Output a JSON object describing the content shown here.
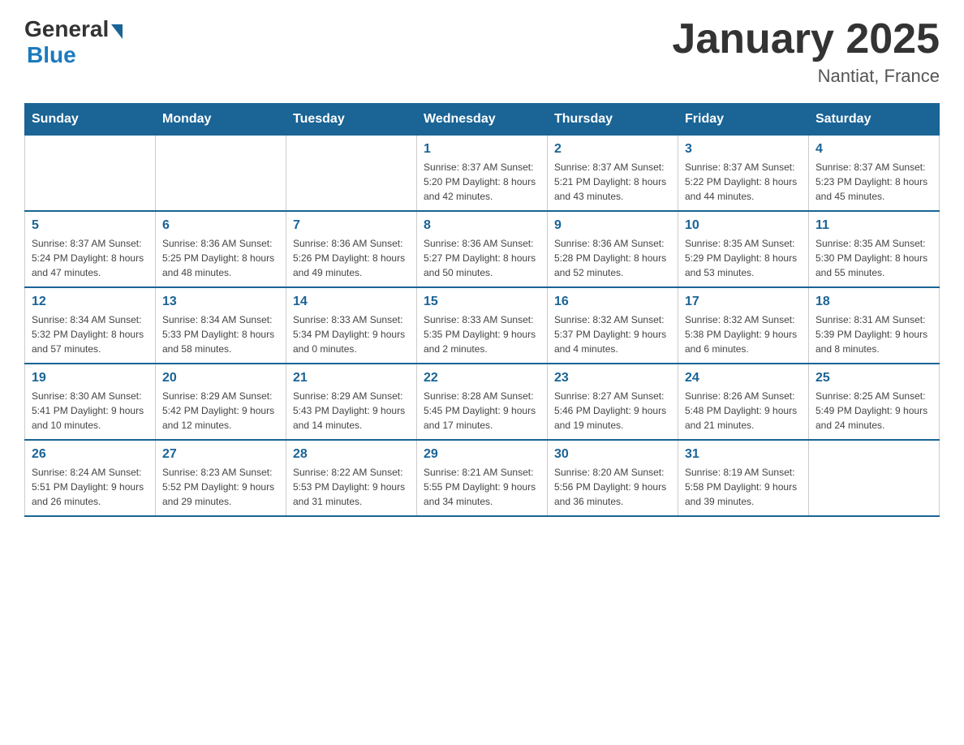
{
  "logo": {
    "general": "General",
    "blue": "Blue"
  },
  "header": {
    "title": "January 2025",
    "location": "Nantiat, France"
  },
  "days_of_week": [
    "Sunday",
    "Monday",
    "Tuesday",
    "Wednesday",
    "Thursday",
    "Friday",
    "Saturday"
  ],
  "weeks": [
    [
      {
        "day": "",
        "info": ""
      },
      {
        "day": "",
        "info": ""
      },
      {
        "day": "",
        "info": ""
      },
      {
        "day": "1",
        "info": "Sunrise: 8:37 AM\nSunset: 5:20 PM\nDaylight: 8 hours\nand 42 minutes."
      },
      {
        "day": "2",
        "info": "Sunrise: 8:37 AM\nSunset: 5:21 PM\nDaylight: 8 hours\nand 43 minutes."
      },
      {
        "day": "3",
        "info": "Sunrise: 8:37 AM\nSunset: 5:22 PM\nDaylight: 8 hours\nand 44 minutes."
      },
      {
        "day": "4",
        "info": "Sunrise: 8:37 AM\nSunset: 5:23 PM\nDaylight: 8 hours\nand 45 minutes."
      }
    ],
    [
      {
        "day": "5",
        "info": "Sunrise: 8:37 AM\nSunset: 5:24 PM\nDaylight: 8 hours\nand 47 minutes."
      },
      {
        "day": "6",
        "info": "Sunrise: 8:36 AM\nSunset: 5:25 PM\nDaylight: 8 hours\nand 48 minutes."
      },
      {
        "day": "7",
        "info": "Sunrise: 8:36 AM\nSunset: 5:26 PM\nDaylight: 8 hours\nand 49 minutes."
      },
      {
        "day": "8",
        "info": "Sunrise: 8:36 AM\nSunset: 5:27 PM\nDaylight: 8 hours\nand 50 minutes."
      },
      {
        "day": "9",
        "info": "Sunrise: 8:36 AM\nSunset: 5:28 PM\nDaylight: 8 hours\nand 52 minutes."
      },
      {
        "day": "10",
        "info": "Sunrise: 8:35 AM\nSunset: 5:29 PM\nDaylight: 8 hours\nand 53 minutes."
      },
      {
        "day": "11",
        "info": "Sunrise: 8:35 AM\nSunset: 5:30 PM\nDaylight: 8 hours\nand 55 minutes."
      }
    ],
    [
      {
        "day": "12",
        "info": "Sunrise: 8:34 AM\nSunset: 5:32 PM\nDaylight: 8 hours\nand 57 minutes."
      },
      {
        "day": "13",
        "info": "Sunrise: 8:34 AM\nSunset: 5:33 PM\nDaylight: 8 hours\nand 58 minutes."
      },
      {
        "day": "14",
        "info": "Sunrise: 8:33 AM\nSunset: 5:34 PM\nDaylight: 9 hours\nand 0 minutes."
      },
      {
        "day": "15",
        "info": "Sunrise: 8:33 AM\nSunset: 5:35 PM\nDaylight: 9 hours\nand 2 minutes."
      },
      {
        "day": "16",
        "info": "Sunrise: 8:32 AM\nSunset: 5:37 PM\nDaylight: 9 hours\nand 4 minutes."
      },
      {
        "day": "17",
        "info": "Sunrise: 8:32 AM\nSunset: 5:38 PM\nDaylight: 9 hours\nand 6 minutes."
      },
      {
        "day": "18",
        "info": "Sunrise: 8:31 AM\nSunset: 5:39 PM\nDaylight: 9 hours\nand 8 minutes."
      }
    ],
    [
      {
        "day": "19",
        "info": "Sunrise: 8:30 AM\nSunset: 5:41 PM\nDaylight: 9 hours\nand 10 minutes."
      },
      {
        "day": "20",
        "info": "Sunrise: 8:29 AM\nSunset: 5:42 PM\nDaylight: 9 hours\nand 12 minutes."
      },
      {
        "day": "21",
        "info": "Sunrise: 8:29 AM\nSunset: 5:43 PM\nDaylight: 9 hours\nand 14 minutes."
      },
      {
        "day": "22",
        "info": "Sunrise: 8:28 AM\nSunset: 5:45 PM\nDaylight: 9 hours\nand 17 minutes."
      },
      {
        "day": "23",
        "info": "Sunrise: 8:27 AM\nSunset: 5:46 PM\nDaylight: 9 hours\nand 19 minutes."
      },
      {
        "day": "24",
        "info": "Sunrise: 8:26 AM\nSunset: 5:48 PM\nDaylight: 9 hours\nand 21 minutes."
      },
      {
        "day": "25",
        "info": "Sunrise: 8:25 AM\nSunset: 5:49 PM\nDaylight: 9 hours\nand 24 minutes."
      }
    ],
    [
      {
        "day": "26",
        "info": "Sunrise: 8:24 AM\nSunset: 5:51 PM\nDaylight: 9 hours\nand 26 minutes."
      },
      {
        "day": "27",
        "info": "Sunrise: 8:23 AM\nSunset: 5:52 PM\nDaylight: 9 hours\nand 29 minutes."
      },
      {
        "day": "28",
        "info": "Sunrise: 8:22 AM\nSunset: 5:53 PM\nDaylight: 9 hours\nand 31 minutes."
      },
      {
        "day": "29",
        "info": "Sunrise: 8:21 AM\nSunset: 5:55 PM\nDaylight: 9 hours\nand 34 minutes."
      },
      {
        "day": "30",
        "info": "Sunrise: 8:20 AM\nSunset: 5:56 PM\nDaylight: 9 hours\nand 36 minutes."
      },
      {
        "day": "31",
        "info": "Sunrise: 8:19 AM\nSunset: 5:58 PM\nDaylight: 9 hours\nand 39 minutes."
      },
      {
        "day": "",
        "info": ""
      }
    ]
  ]
}
